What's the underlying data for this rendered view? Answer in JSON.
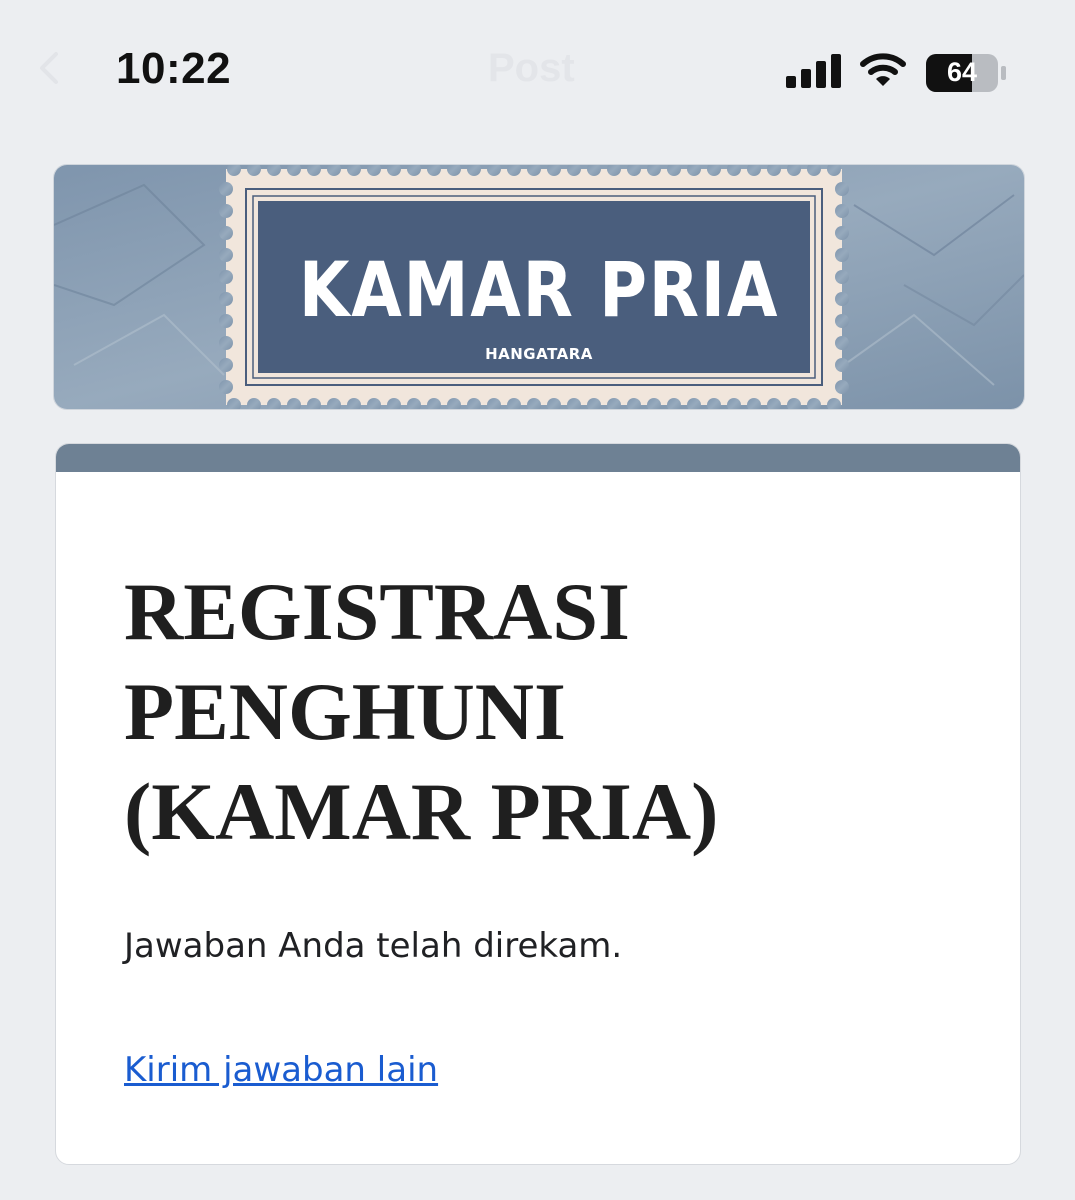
{
  "status_bar": {
    "time": "10:22",
    "faded_title": "Post",
    "battery_level": "64"
  },
  "banner": {
    "title": "KAMAR PRIA",
    "subtitle": "HANGATARA"
  },
  "form": {
    "title": "REGISTRASI PENGHUNI (KAMAR PRIA)",
    "confirmation": "Jawaban Anda telah direkam.",
    "submit_another_link": "Kirim jawaban lain"
  },
  "colors": {
    "background": "#eceef1",
    "accent_strip": "#6e8194",
    "stamp_blue": "#4a5e7d",
    "link": "#1a5cd0"
  }
}
